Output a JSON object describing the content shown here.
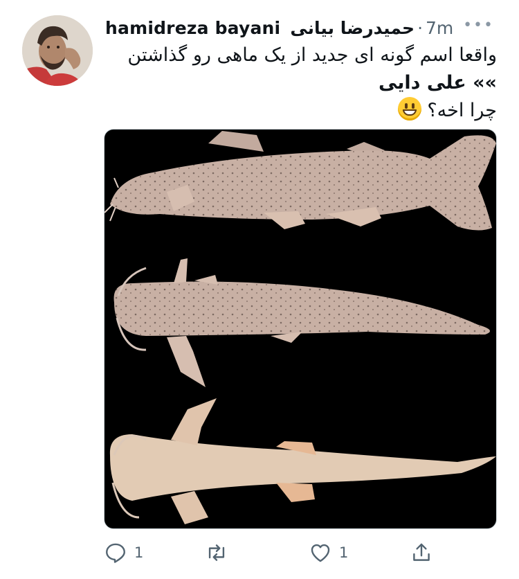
{
  "tweet": {
    "author": {
      "display_name": "hamidreza bayani",
      "display_name_fa": "حمیدرضا بیانی",
      "timestamp": "7m"
    },
    "text": {
      "line1": "واقعا اسم گونه ای جدید از یک ماهی رو گذاشتن",
      "line2": "»» علی دایی",
      "line3": "چرا اخه؟",
      "emoji": "grinning-face-emoji"
    },
    "media": {
      "alt": "three views of a pale spotted catfish on black background"
    },
    "actions": {
      "reply_count": "1",
      "retweet_count": "",
      "like_count": "1"
    }
  },
  "colors": {
    "text": "#0f1419",
    "secondary": "#536471",
    "media_bg": "#000000",
    "fish_body": "#c9b3a6",
    "fish_belly": "#e2cbb4"
  }
}
